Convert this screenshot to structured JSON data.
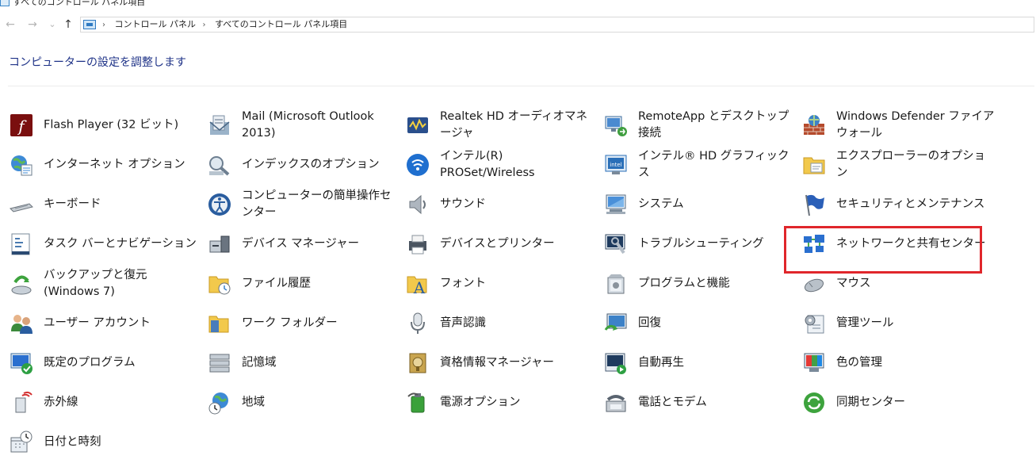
{
  "window": {
    "title": "すべてのコントロール パネル項目"
  },
  "nav": {
    "back": "←",
    "forward": "→",
    "recent": "⌄",
    "up": "↑"
  },
  "address": {
    "crumbs": [
      "コントロール パネル",
      "すべてのコントロール パネル項目"
    ],
    "separator": "›"
  },
  "heading": "コンピューターの設定を調整します",
  "items": [
    {
      "label": "Flash Player (32 ビット)",
      "icon": "flash-icon"
    },
    {
      "label": "Mail (Microsoft Outlook 2013)",
      "icon": "mail-icon"
    },
    {
      "label": "Realtek HD オーディオマネージャ",
      "icon": "realtek-audio-icon"
    },
    {
      "label": "RemoteApp とデスクトップ接続",
      "icon": "remote-desktop-icon"
    },
    {
      "label": "Windows Defender ファイアウォール",
      "icon": "firewall-icon"
    },
    {
      "label": "インターネット オプション",
      "icon": "internet-options-icon"
    },
    {
      "label": "インデックスのオプション",
      "icon": "indexing-icon"
    },
    {
      "label": "インテル(R) PROSet/Wireless",
      "icon": "wireless-icon"
    },
    {
      "label": "インテル® HD グラフィックス",
      "icon": "intel-graphics-icon"
    },
    {
      "label": "エクスプローラーのオプション",
      "icon": "folder-options-icon"
    },
    {
      "label": "キーボード",
      "icon": "keyboard-icon"
    },
    {
      "label": "コンピューターの簡単操作センター",
      "icon": "ease-of-access-icon"
    },
    {
      "label": "サウンド",
      "icon": "sound-icon"
    },
    {
      "label": "システム",
      "icon": "system-icon"
    },
    {
      "label": "セキュリティとメンテナンス",
      "icon": "security-flag-icon"
    },
    {
      "label": "タスク バーとナビゲーション",
      "icon": "taskbar-icon"
    },
    {
      "label": "デバイス マネージャー",
      "icon": "device-manager-icon"
    },
    {
      "label": "デバイスとプリンター",
      "icon": "printer-icon"
    },
    {
      "label": "トラブルシューティング",
      "icon": "troubleshooting-icon"
    },
    {
      "label": "ネットワークと共有センター",
      "icon": "network-icon"
    },
    {
      "label": "バックアップと復元 (Windows 7)",
      "icon": "backup-icon"
    },
    {
      "label": "ファイル履歴",
      "icon": "file-history-icon"
    },
    {
      "label": "フォント",
      "icon": "font-icon"
    },
    {
      "label": "プログラムと機能",
      "icon": "programs-icon"
    },
    {
      "label": "マウス",
      "icon": "mouse-icon"
    },
    {
      "label": "ユーザー アカウント",
      "icon": "user-accounts-icon"
    },
    {
      "label": "ワーク フォルダー",
      "icon": "work-folders-icon"
    },
    {
      "label": "音声認識",
      "icon": "microphone-icon"
    },
    {
      "label": "回復",
      "icon": "recovery-icon"
    },
    {
      "label": "管理ツール",
      "icon": "admin-tools-icon"
    },
    {
      "label": "既定のプログラム",
      "icon": "default-programs-icon"
    },
    {
      "label": "記憶域",
      "icon": "storage-icon"
    },
    {
      "label": "資格情報マネージャー",
      "icon": "credential-icon"
    },
    {
      "label": "自動再生",
      "icon": "autoplay-icon"
    },
    {
      "label": "色の管理",
      "icon": "color-management-icon"
    },
    {
      "label": "赤外線",
      "icon": "infrared-icon"
    },
    {
      "label": "地域",
      "icon": "region-icon"
    },
    {
      "label": "電源オプション",
      "icon": "power-icon"
    },
    {
      "label": "電話とモデム",
      "icon": "phone-modem-icon"
    },
    {
      "label": "同期センター",
      "icon": "sync-icon"
    },
    {
      "label": "日付と時刻",
      "icon": "date-time-icon"
    }
  ]
}
